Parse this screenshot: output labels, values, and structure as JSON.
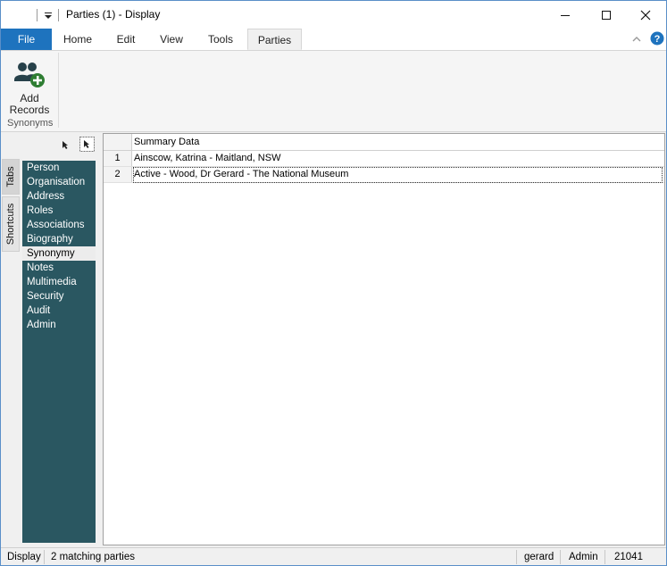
{
  "window": {
    "title": "Parties (1) - Display"
  },
  "ribbon_tabs": {
    "file": "File",
    "home": "Home",
    "edit": "Edit",
    "view": "View",
    "tools": "Tools",
    "parties": "Parties"
  },
  "ribbon": {
    "add_records_line1": "Add",
    "add_records_line2": "Records",
    "group_label": "Synonyms",
    "add_icon": "add-user-icon",
    "accent": "#2e7d32"
  },
  "side_tabs": {
    "tabs": "Tabs",
    "shortcuts": "Shortcuts"
  },
  "nav": {
    "items": [
      "Person",
      "Organisation",
      "Address",
      "Roles",
      "Associations",
      "Biography",
      "Synonymy",
      "Notes",
      "Multimedia",
      "Security",
      "Audit",
      "Admin"
    ],
    "selected": "Synonymy"
  },
  "grid": {
    "column_header": "Summary Data",
    "rows": [
      {
        "num": "1",
        "text": "Ainscow, Katrina - Maitland, NSW"
      },
      {
        "num": "2",
        "text": "Active - Wood, Dr Gerard - The National Museum"
      }
    ]
  },
  "status": {
    "mode": "Display",
    "matches": "2 matching parties",
    "user": "gerard",
    "role": "Admin",
    "id": "21041"
  },
  "colors": {
    "file_tab": "#1e73be",
    "nav_bg": "#2a5761",
    "help": "#1e73be"
  }
}
